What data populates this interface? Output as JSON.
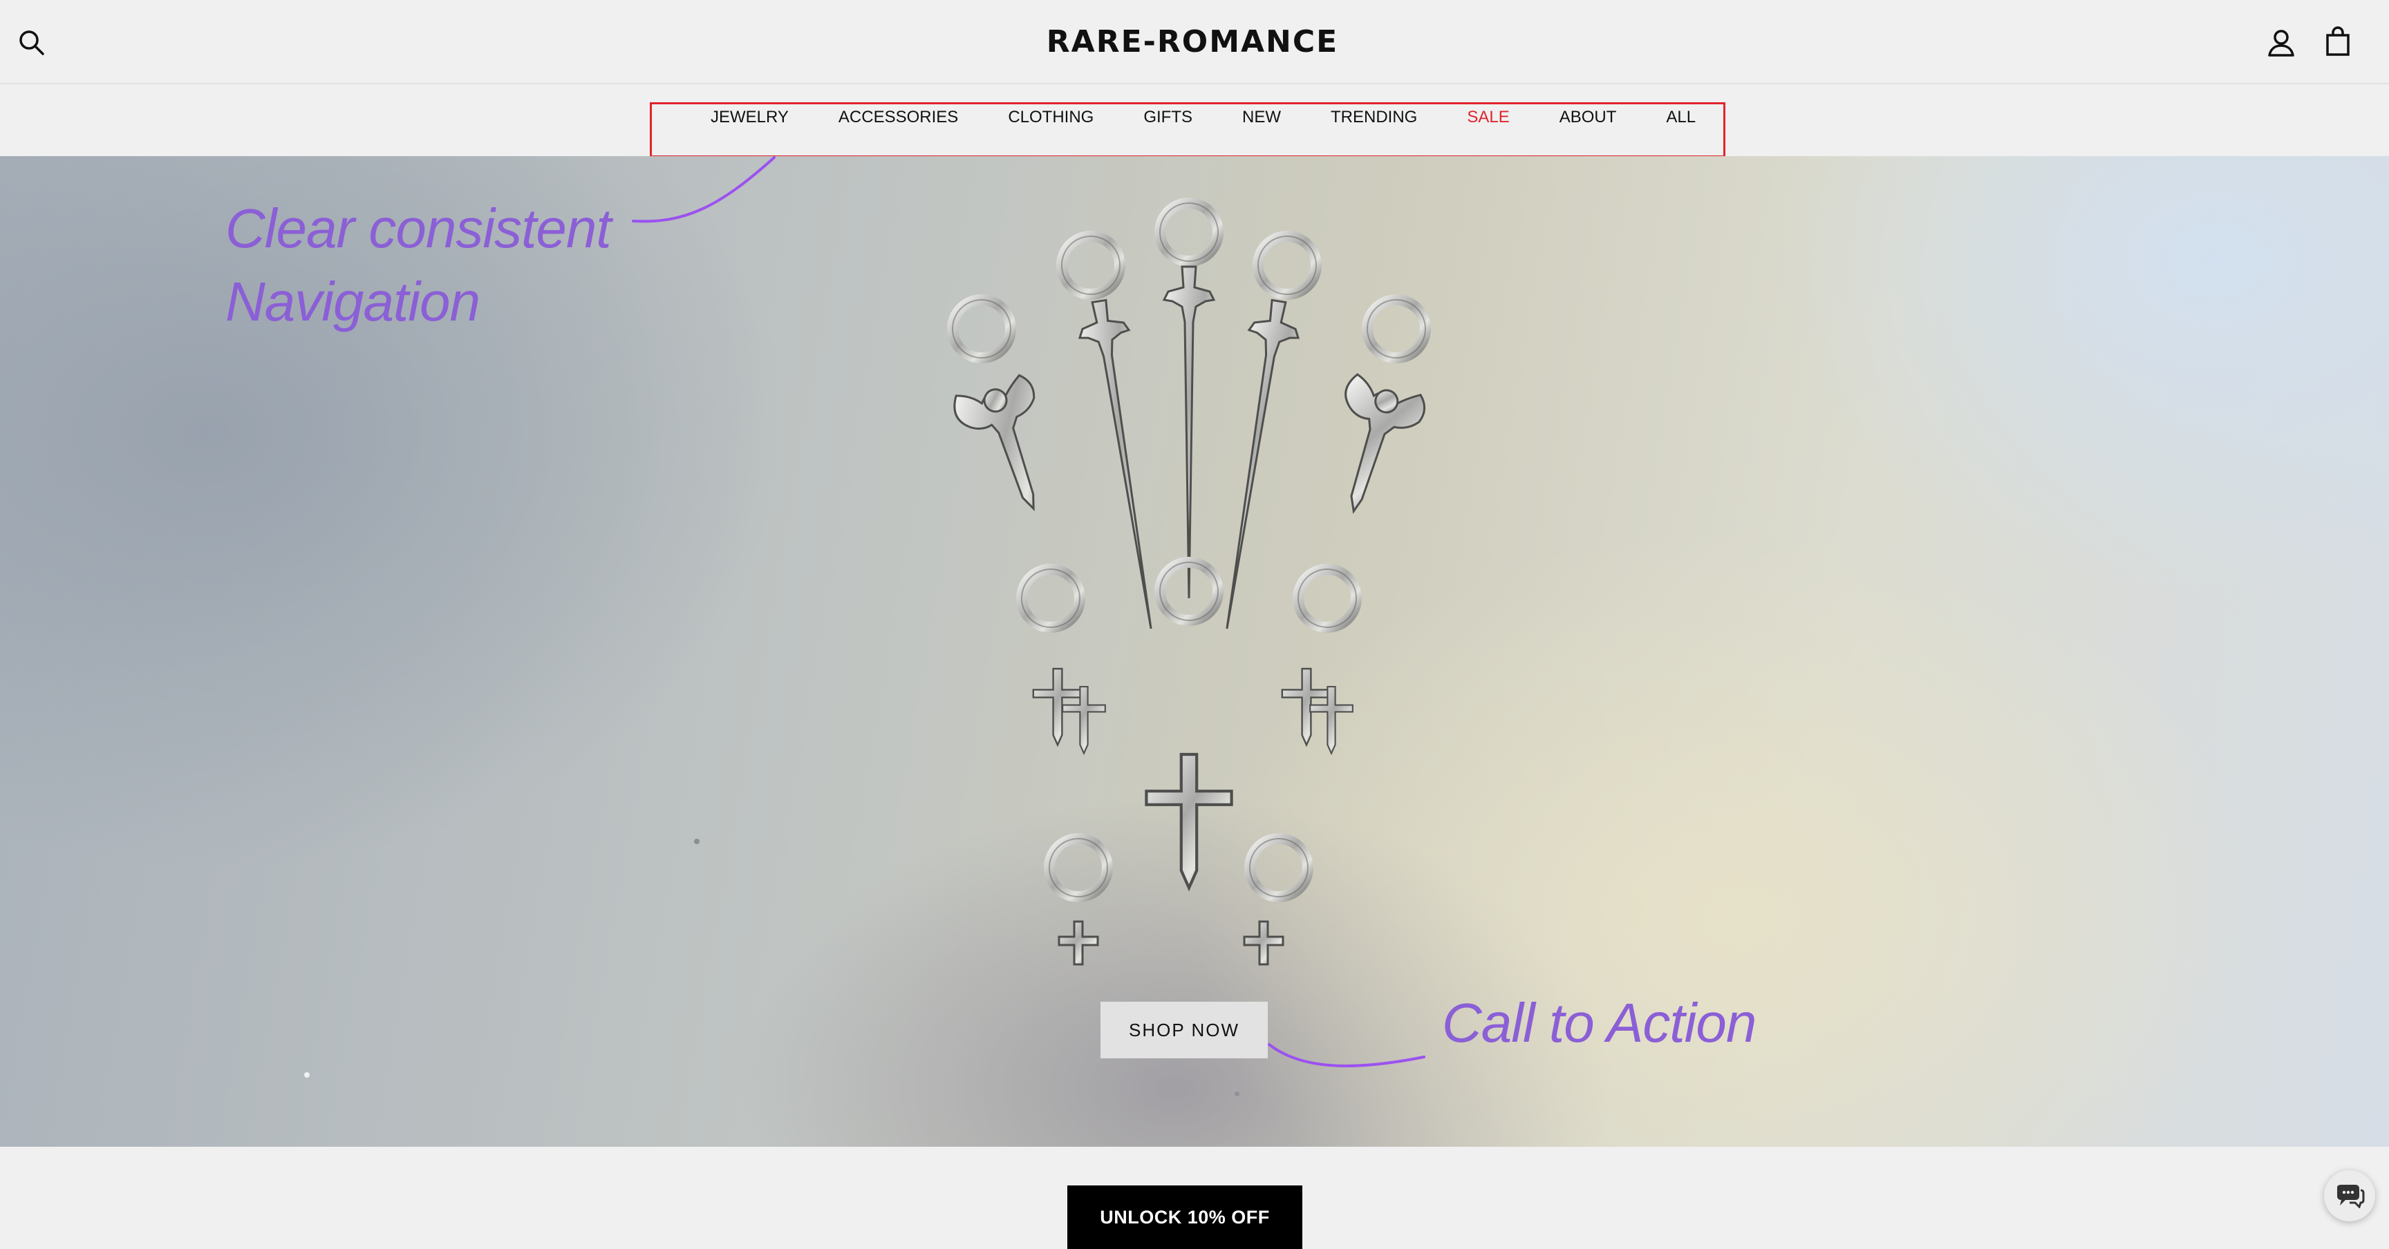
{
  "header": {
    "logo_text": "RARE-ROMANCE",
    "search_icon": "search-icon",
    "account_icon": "user-icon",
    "cart_icon": "bag-icon"
  },
  "nav": {
    "items": [
      {
        "label": "JEWELRY"
      },
      {
        "label": "ACCESSORIES"
      },
      {
        "label": "CLOTHING"
      },
      {
        "label": "GIFTS"
      },
      {
        "label": "NEW"
      },
      {
        "label": "TRENDING"
      },
      {
        "label": "SALE"
      },
      {
        "label": "ABOUT"
      },
      {
        "label": "ALL"
      }
    ],
    "sale_color": "#e0242c",
    "highlight_color": "#e0242c"
  },
  "hero": {
    "annotation_nav_line1": "Clear consistent",
    "annotation_nav_line2": "Navigation",
    "annotation_cta": "Call to Action",
    "annotation_color": "#8b5fd6",
    "cta_label": "SHOP NOW"
  },
  "footer": {
    "unlock_label": "UNLOCK 10% OFF",
    "chat_icon": "chat-icon"
  }
}
